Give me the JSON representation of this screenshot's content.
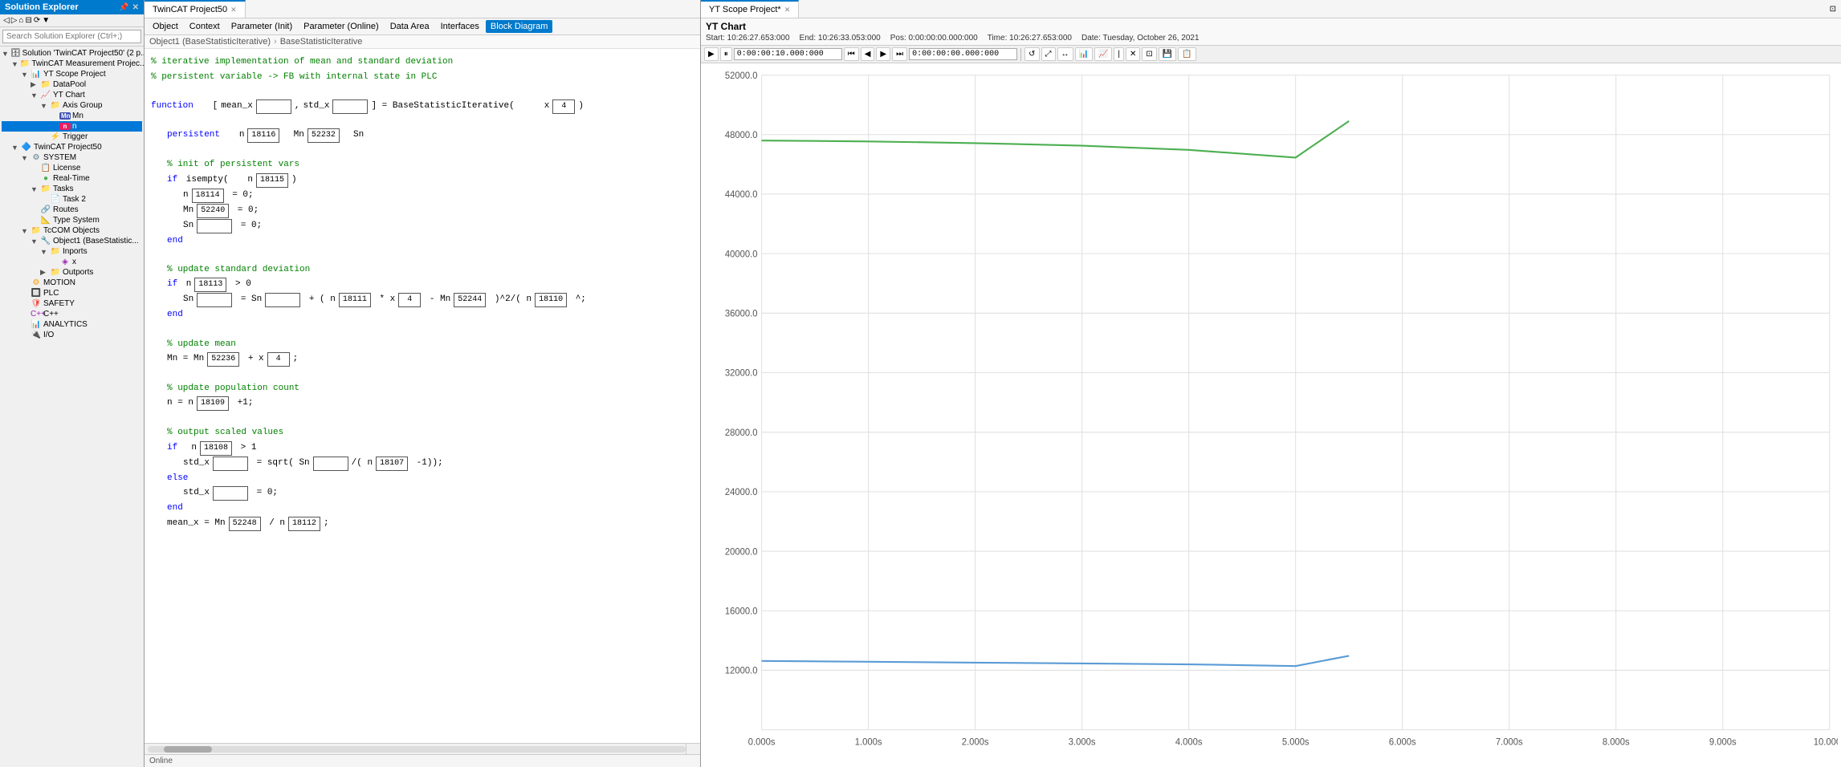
{
  "app": {
    "title": "Solution Explorer"
  },
  "solution_explorer": {
    "header": "Solution Explorer",
    "search_placeholder": "Search Solution Explorer (Ctrl+;)",
    "tree": [
      {
        "id": "solution",
        "label": "Solution 'TwinCAT Project50' (2 p...",
        "indent": 0,
        "expanded": true,
        "icon": "solution"
      },
      {
        "id": "twincat-measurement",
        "label": "TwinCAT Measurement Projec...",
        "indent": 1,
        "expanded": true,
        "icon": "project"
      },
      {
        "id": "yt-scope",
        "label": "YT Scope Project",
        "indent": 2,
        "expanded": true,
        "icon": "scope"
      },
      {
        "id": "datapool",
        "label": "DataPool",
        "indent": 3,
        "expanded": false,
        "icon": "folder"
      },
      {
        "id": "yt-chart",
        "label": "YT Chart",
        "indent": 3,
        "expanded": true,
        "icon": "chart"
      },
      {
        "id": "axis-group",
        "label": "Axis Group",
        "indent": 4,
        "expanded": true,
        "icon": "folder"
      },
      {
        "id": "mn",
        "label": "Mn",
        "indent": 5,
        "icon": "mn"
      },
      {
        "id": "n",
        "label": "n",
        "indent": 5,
        "icon": "n",
        "selected": true
      },
      {
        "id": "trigger",
        "label": "Trigger",
        "indent": 4,
        "icon": "trigger"
      },
      {
        "id": "twincat-project50",
        "label": "TwinCAT Project50",
        "indent": 1,
        "expanded": true,
        "icon": "project"
      },
      {
        "id": "system",
        "label": "SYSTEM",
        "indent": 2,
        "expanded": true,
        "icon": "system"
      },
      {
        "id": "license",
        "label": "License",
        "indent": 3,
        "icon": "license"
      },
      {
        "id": "real-time",
        "label": "Real-Time",
        "indent": 3,
        "icon": "realtime"
      },
      {
        "id": "tasks",
        "label": "Tasks",
        "indent": 3,
        "expanded": true,
        "icon": "folder"
      },
      {
        "id": "task2",
        "label": "Task 2",
        "indent": 4,
        "icon": "task"
      },
      {
        "id": "routes",
        "label": "Routes",
        "indent": 3,
        "icon": "routes"
      },
      {
        "id": "type-system",
        "label": "Type System",
        "indent": 3,
        "icon": "types"
      },
      {
        "id": "tccom",
        "label": "TcCOM Objects",
        "indent": 2,
        "expanded": true,
        "icon": "folder"
      },
      {
        "id": "object1",
        "label": "Object1 (BaseStatistic...",
        "indent": 3,
        "expanded": true,
        "icon": "object"
      },
      {
        "id": "inports",
        "label": "Inports",
        "indent": 4,
        "expanded": true,
        "icon": "folder"
      },
      {
        "id": "x-inport",
        "label": "x",
        "indent": 5,
        "icon": "port"
      },
      {
        "id": "outports",
        "label": "Outports",
        "indent": 4,
        "icon": "folder"
      },
      {
        "id": "motion",
        "label": "MOTION",
        "indent": 2,
        "icon": "motion"
      },
      {
        "id": "plc",
        "label": "PLC",
        "indent": 2,
        "icon": "plc"
      },
      {
        "id": "safety",
        "label": "SAFETY",
        "indent": 2,
        "icon": "safety"
      },
      {
        "id": "cpp",
        "label": "C++",
        "indent": 2,
        "icon": "cpp"
      },
      {
        "id": "analytics",
        "label": "ANALYTICS",
        "indent": 2,
        "icon": "analytics"
      },
      {
        "id": "io",
        "label": "I/O",
        "indent": 2,
        "icon": "io"
      }
    ]
  },
  "editor": {
    "tabs": [
      {
        "label": "TwinCAT Project50",
        "active": false
      },
      {
        "label": "×",
        "close": true
      }
    ],
    "menu_items": [
      "Object",
      "Context",
      "Parameter (Init)",
      "Parameter (Online)",
      "Data Area",
      "Interfaces",
      "Block Diagram"
    ],
    "active_menu": "Block Diagram",
    "breadcrumb": [
      "Object1 (BaseStatisticIterative)",
      "BaseStatisticIterative"
    ],
    "code": {
      "comments": [
        "% iterative implementation of mean and standard deviation",
        "% persistent variable -> FB with internal state in PLC"
      ],
      "function_sig": "function   [ mean_x",
      "std_x_label": "std_x",
      "func_name": "= BaseStatisticIterative(",
      "x_label": "x",
      "x_val": "4",
      "persistent_label": "persistent",
      "n_label": "n",
      "n_val_18116": "18116",
      "mn_label": "Mn",
      "mn_val_52232": "52232",
      "sn_label": "Sn",
      "init_comment": "% init of persistent vars",
      "isempty_n": "18115",
      "n_18114": "18114",
      "mn_52240": "52240",
      "update_std_comment": "% update standard deviation",
      "n_18113": "18113",
      "n_18111": "18111",
      "x_4": "4",
      "mn_52244": "52244",
      "n_18110": "18110",
      "update_mean_comment": "% update mean",
      "mn_52236": "52236",
      "x_4b": "4",
      "update_pop_comment": "% update population count",
      "n_18109": "18109",
      "output_comment": "% output scaled values",
      "n_18108": "18108",
      "n_18107": "18107",
      "n_18112": "18112",
      "mn_52248": "52248"
    }
  },
  "scope": {
    "title": "YT Scope Project*",
    "chart_title": "YT Chart",
    "header": {
      "start": "Start: 10:26:27.653:000",
      "end": "End: 10:26:33.053:000",
      "pos": "Pos: 0:00:00:00.000:000",
      "time": "Time: 10:26:27.653:000",
      "date": "Date: Tuesday, October 26, 2021"
    },
    "toolbar": {
      "time_from": "0:00:00:10.000:000",
      "time_to": "0:00:00:00.000:000"
    },
    "chart": {
      "y_labels": [
        "52000.0",
        "48000.0",
        "44000.0",
        "40000.0",
        "36000.0",
        "32000.0",
        "28000.0",
        "24000.0",
        "20000.0",
        "16000.0",
        "12000.0"
      ],
      "x_labels": [
        "0.000s",
        "1.000s",
        "2.000s",
        "3.000s",
        "4.000s",
        "5.000s",
        "6.000s",
        "7.000s",
        "8.000s",
        "9.000s",
        "10.000s"
      ],
      "green_line": [
        [
          0,
          47800
        ],
        [
          1000,
          47850
        ],
        [
          2000,
          47900
        ],
        [
          3000,
          48000
        ],
        [
          4000,
          48200
        ],
        [
          5000,
          48800
        ],
        [
          5500,
          49200
        ]
      ],
      "blue_line": [
        [
          0,
          16200
        ],
        [
          1000,
          16220
        ],
        [
          2000,
          16250
        ],
        [
          3000,
          16280
        ],
        [
          4000,
          16320
        ],
        [
          5000,
          16400
        ],
        [
          5500,
          16500
        ]
      ]
    }
  }
}
